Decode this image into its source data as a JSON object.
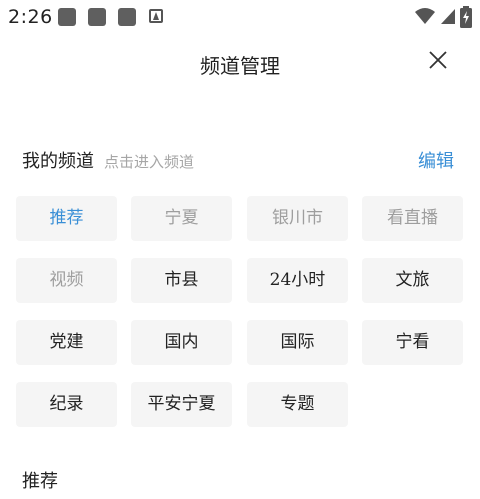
{
  "status": {
    "time": "2:26",
    "notification_icons": [
      "app-notification-icon",
      "app-notification-icon",
      "app-notification-icon",
      "accessibility-notification-icon"
    ],
    "system_icons": [
      "wifi-icon",
      "cellular-signal-icon",
      "battery-charging-icon"
    ]
  },
  "header": {
    "title": "频道管理",
    "close_icon": "close-icon"
  },
  "my_channels": {
    "title": "我的频道",
    "hint": "点击进入频道",
    "edit_label": "编辑",
    "items": [
      {
        "label": "推荐",
        "state": "active"
      },
      {
        "label": "宁夏",
        "state": "fixed"
      },
      {
        "label": "银川市",
        "state": "fixed"
      },
      {
        "label": "看直播",
        "state": "fixed"
      },
      {
        "label": "视频",
        "state": "fixed"
      },
      {
        "label": "市县",
        "state": "normal"
      },
      {
        "label": "24小时",
        "state": "normal"
      },
      {
        "label": "文旅",
        "state": "normal"
      },
      {
        "label": "党建",
        "state": "normal"
      },
      {
        "label": "国内",
        "state": "normal"
      },
      {
        "label": "国际",
        "state": "normal"
      },
      {
        "label": "宁看",
        "state": "normal"
      },
      {
        "label": "纪录",
        "state": "normal"
      },
      {
        "label": "平安宁夏",
        "state": "normal"
      },
      {
        "label": "专题",
        "state": "normal"
      }
    ]
  },
  "recommended": {
    "title": "推荐"
  },
  "colors": {
    "accent": "#3a8fd6",
    "chip_bg": "#f5f5f5",
    "fixed_text": "#9e9e9e",
    "hint_text": "#a6a6a6"
  }
}
